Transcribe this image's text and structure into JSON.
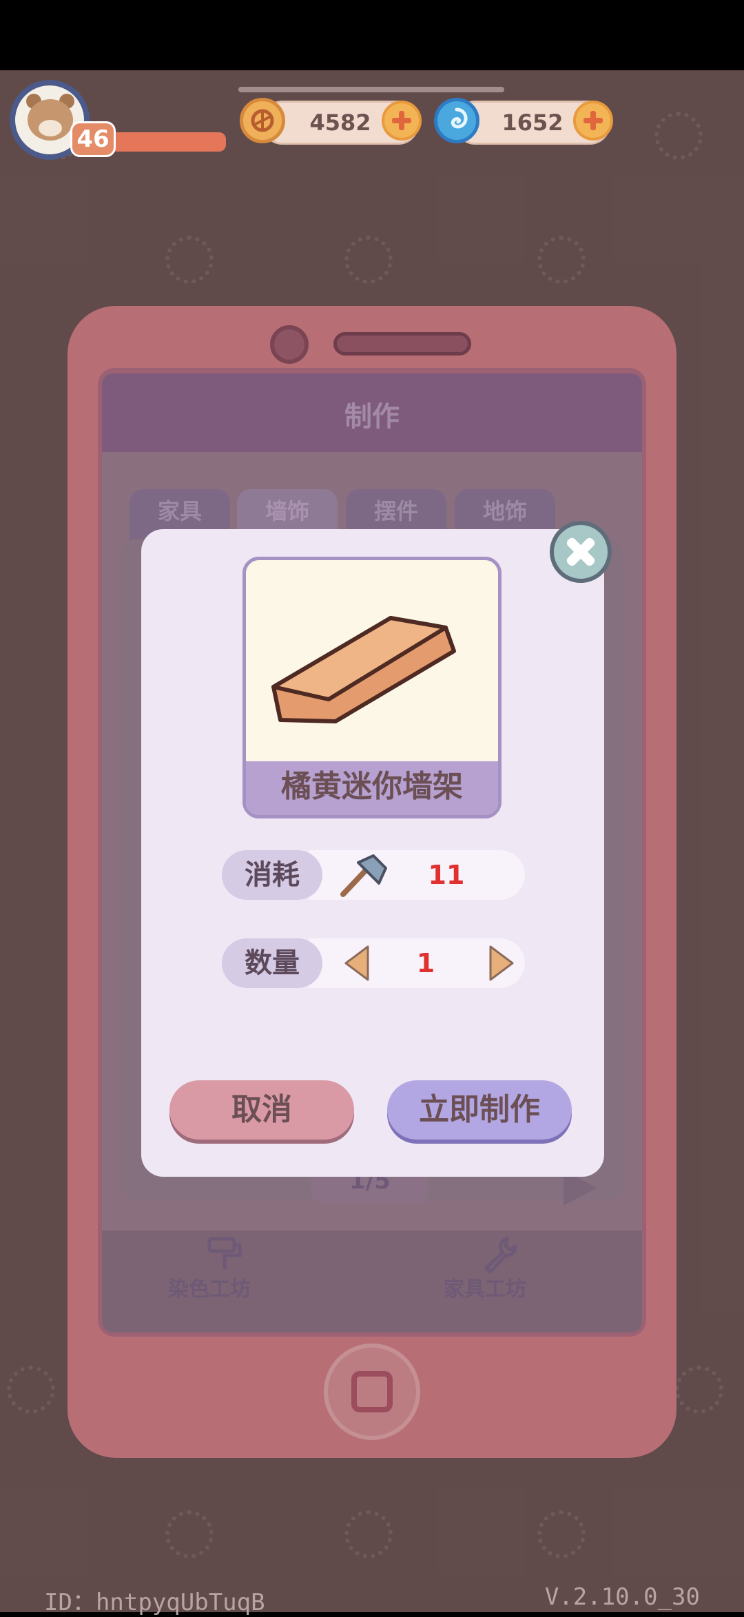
{
  "hud": {
    "level": "46",
    "coins": "4582",
    "gems": "1652"
  },
  "workshop": {
    "title": "制作",
    "tabs": [
      "家具",
      "墙饰",
      "摆件",
      "地饰"
    ],
    "page": "1/5",
    "footer_left": "染色工坊",
    "footer_right": "家具工坊"
  },
  "dialog": {
    "item_name": "橘黄迷你墙架",
    "cost_label": "消耗",
    "cost_value": "11",
    "quantity_label": "数量",
    "quantity_value": "1",
    "cancel_label": "取消",
    "confirm_label": "立即制作"
  },
  "footer": {
    "id": "ID：hntpyqUbTuqB",
    "version": "V.2.10.0_30"
  }
}
